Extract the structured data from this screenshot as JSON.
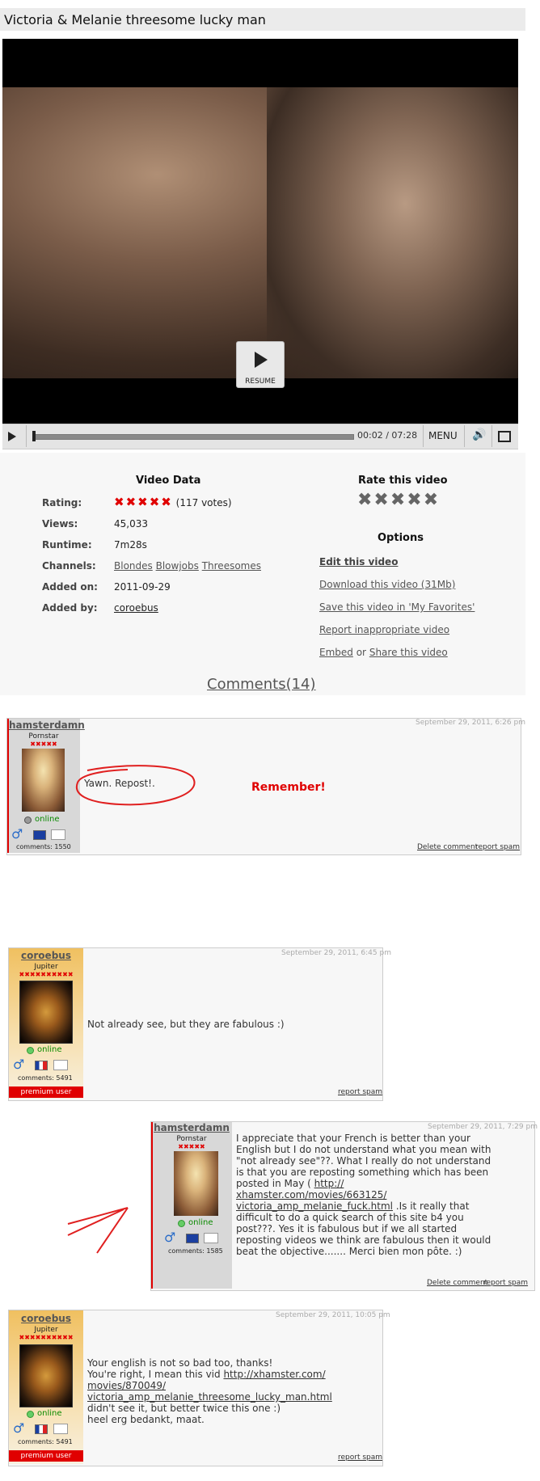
{
  "page": {
    "title": "Victoria & Melanie threesome lucky man"
  },
  "player": {
    "resume_label": "RESUME",
    "time": "00:02 / 07:28",
    "menu_label": "MENU",
    "progress_fraction": 0.004
  },
  "video_data": {
    "heading": "Video Data",
    "rating_label": "Rating:",
    "rating_stars": "✖✖✖✖✖",
    "rating_votes": "(117 votes)",
    "views_label": "Views:",
    "views": "45,033",
    "runtime_label": "Runtime:",
    "runtime": "7m28s",
    "channels_label": "Channels:",
    "channels": [
      "Blondes",
      "Blowjobs",
      "Threesomes"
    ],
    "added_on_label": "Added on:",
    "added_on": "2011-09-29",
    "added_by_label": "Added by:",
    "added_by": "coroebus"
  },
  "rate": {
    "heading": "Rate this video",
    "stars": "✖✖✖✖✖"
  },
  "options": {
    "heading": "Options",
    "edit": "Edit this video",
    "download": "Download this video (31Mb)",
    "save": "Save this video in 'My Favorites'",
    "report": "Report inappropriate video",
    "embed": "Embed",
    "or": "or",
    "share": "Share this video"
  },
  "comments_link": "Comments(14)",
  "comments": [
    {
      "user": "hamsterdamn",
      "rank": "Pornstar",
      "rank_stars": "✖✖✖✖✖",
      "online": "online",
      "count": "comments: 1550",
      "date": "September 29, 2011, 6:26 pm",
      "text": "Yawn. Repost!.",
      "annotation": "Remember!",
      "delete": "Delete comment",
      "spam": "report spam"
    },
    {
      "user": "coroebus",
      "rank": "Jupiter",
      "rank_stars": "✖✖✖✖✖✖✖✖✖✖",
      "online": "online",
      "count": "comments: 5491",
      "premium": "premium user",
      "date": "September 29, 2011, 6:45 pm",
      "text": "Not already see, but they are fabulous :)",
      "spam": "report spam"
    },
    {
      "user": "hamsterdamn",
      "rank": "Pornstar",
      "rank_stars": "✖✖✖✖✖",
      "online": "online",
      "count": "comments: 1585",
      "date": "September 29, 2011, 7:29 pm",
      "text_a": "I appreciate that your French is better than your English but I do not understand what you mean with \"not already see\"??. What I really do not understand is that you are reposting something which has been posted in May ( ",
      "link": "http://xhamster.com/movies/663125/victoria_amp_melanie_fuck.html",
      "link_l1": "http://",
      "link_l2": "xhamster.com/movies/663125/",
      "link_l3": "victoria_amp_melanie_fuck.html",
      "text_b": " .Is it really that difficult to do a quick search of this site b4 you post???. Yes it is fabulous but if we all started reposting videos we think are fabulous then it would beat the objective....... Merci bien mon pôte. :)",
      "delete": "Delete comment",
      "spam": "report spam"
    },
    {
      "user": "coroebus",
      "rank": "Jupiter",
      "rank_stars": "✖✖✖✖✖✖✖✖✖✖",
      "online": "online",
      "count": "comments: 5491",
      "premium": "premium user",
      "date": "September 29, 2011, 10:05 pm",
      "line1": "Your english is not so bad too, thanks!",
      "line2a": "You're right, I mean this vid ",
      "link_l1": "http://xhamster.com/",
      "link_l2": "movies/870049/",
      "link_l3": "victoria_amp_melanie_threesome_lucky_man.html",
      "line3": "didn't see it, but better twice this one :)",
      "line4": "heel erg bedankt, maat.",
      "spam": "report spam"
    }
  ]
}
